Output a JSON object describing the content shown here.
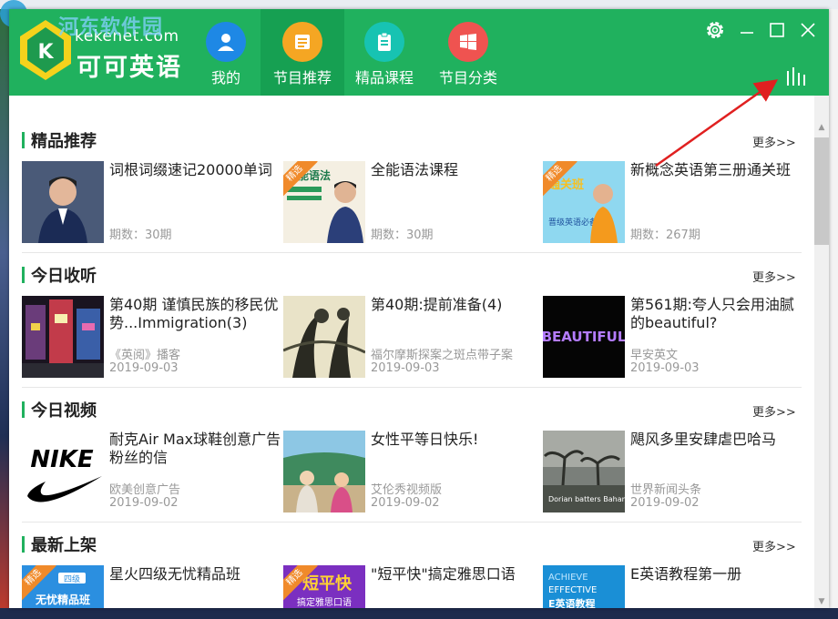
{
  "desktop": {
    "watermark": "河东软件园"
  },
  "app": {
    "logo_url": "kekenet.com",
    "logo_name": "可可英语"
  },
  "nav": [
    {
      "label": "我的",
      "icon": "user-icon",
      "color": "#1e88e5"
    },
    {
      "label": "节目推荐",
      "icon": "list-icon",
      "color": "#f5a623"
    },
    {
      "label": "精品课程",
      "icon": "clipboard-icon",
      "color": "#17c3b2"
    },
    {
      "label": "节目分类",
      "icon": "windows-grid-icon",
      "color": "#ef5350"
    }
  ],
  "window_controls": [
    "settings-icon",
    "minimize-icon",
    "maximize-icon",
    "close-icon"
  ],
  "stats_icon": "bar-stats-icon",
  "more_label": "更多>>",
  "badge_label": "精选",
  "sections": [
    {
      "title": "精品推荐",
      "items": [
        {
          "title": "词根词缀速记20000单词",
          "meta": "期数：30期"
        },
        {
          "title": "全能语法课程",
          "meta": "期数：30期"
        },
        {
          "title": "新概念英语第三册通关班",
          "meta": "期数：267期"
        }
      ]
    },
    {
      "title": "今日收听",
      "items": [
        {
          "title": "第40期 谨慎民族的移民优势...Immigration(3)",
          "sub": "《英阅》播客",
          "date": "2019-09-03"
        },
        {
          "title": "第40期:提前准备(4)",
          "sub": "福尔摩斯探案之斑点带子案",
          "date": "2019-09-03"
        },
        {
          "title": "第561期:夸人只会用油腻的beautiful?",
          "sub": "早安英文",
          "date": "2019-09-03"
        }
      ]
    },
    {
      "title": "今日视频",
      "items": [
        {
          "title": "耐克Air Max球鞋创意广告粉丝的信",
          "sub": "欧美创意广告",
          "date": "2019-09-02"
        },
        {
          "title": "女性平等日快乐!",
          "sub": "艾伦秀视频版",
          "date": "2019-09-02"
        },
        {
          "title": "飓风多里安肆虐巴哈马",
          "sub": "世界新闻头条",
          "date": "2019-09-02"
        }
      ]
    },
    {
      "title": "最新上架",
      "items": [
        {
          "title": "星火四级无忧精品班"
        },
        {
          "title": "\"短平快\"搞定雅思口语"
        },
        {
          "title": "E英语教程第一册"
        }
      ]
    }
  ],
  "thumb_text": {
    "grammar": "全能语法",
    "nce": "通关班",
    "nce_sub": "晋级英语必备",
    "beautiful": "BEAUTIFUL",
    "nike": "NIKE",
    "news_caption": "Dorian batters Bahamas",
    "cet4": "无忧精品班",
    "cet4_top": "四级",
    "ielts": "短平快",
    "ielts_sub": "搞定雅思口语",
    "eng_line1": "ACHIEVE",
    "eng_line2": "EFFECTIVE",
    "eng_line3": "E英语教程"
  }
}
